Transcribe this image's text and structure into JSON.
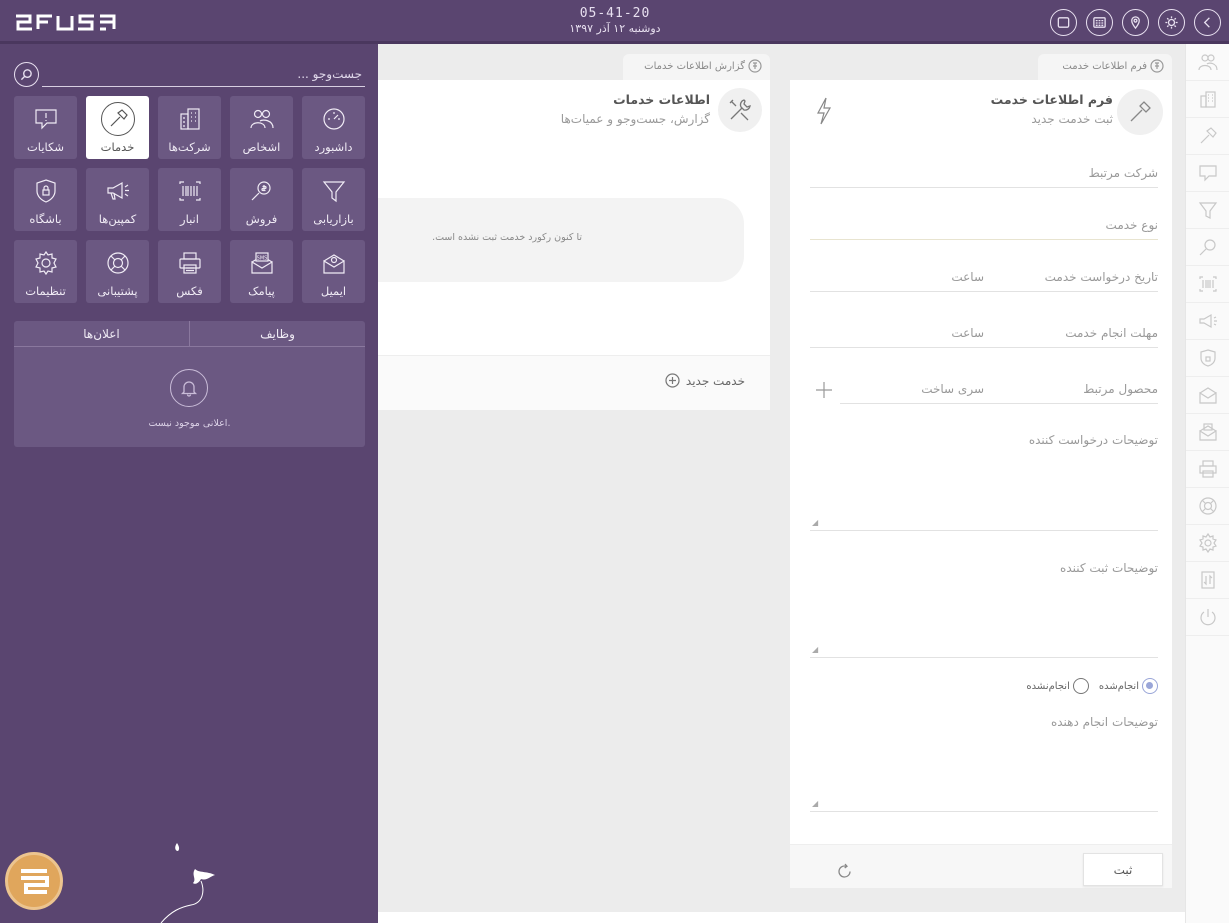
{
  "header": {
    "time": "05-41-20",
    "date": "دوشنبه ۱۲ آذر ۱۳۹۷",
    "icons": [
      "chevron-left-icon",
      "sun-icon",
      "map-pin-icon",
      "calendar-grid-icon",
      "window-icon"
    ]
  },
  "sidebar": {
    "search_placeholder": "جست‌وجو ...",
    "tiles": [
      {
        "label": "داشبورد",
        "icon": "dashboard-icon"
      },
      {
        "label": "اشخاص",
        "icon": "people-icon"
      },
      {
        "label": "شرکت‌ها",
        "icon": "buildings-icon"
      },
      {
        "label": "خدمات",
        "icon": "hammer-icon"
      },
      {
        "label": "شکایات",
        "icon": "complaint-icon"
      },
      {
        "label": "بازاریابی",
        "icon": "funnel-icon"
      },
      {
        "label": "فروش",
        "icon": "sales-icon"
      },
      {
        "label": "انبار",
        "icon": "barcode-icon"
      },
      {
        "label": "کمپین‌ها",
        "icon": "megaphone-icon"
      },
      {
        "label": "باشگاه",
        "icon": "shield-lock-icon"
      },
      {
        "label": "ایمیل",
        "icon": "email-icon"
      },
      {
        "label": "پیامک",
        "icon": "sms-icon"
      },
      {
        "label": "فکس",
        "icon": "printer-icon"
      },
      {
        "label": "پشتیبانی",
        "icon": "lifebuoy-icon"
      },
      {
        "label": "تنظیمات",
        "icon": "gear-icon"
      }
    ],
    "tabs": {
      "tasks": "وظایف",
      "announcements": "اعلان‌ها"
    },
    "announcements_empty": "اعلانی موجود نیست."
  },
  "report": {
    "tab_label": "گزارش اطلاعات خدمات",
    "title": "اطلاعات خدمات",
    "subtitle": "گزارش، جست‌وجو و عمیات‌ها",
    "empty": "تا کنون رکورد خدمت ثبت نشده است.",
    "new_service": "خدمت جدید"
  },
  "form": {
    "tab_label": "فرم اطلاعات خدمت",
    "title": "فرم اطلاعات خدمت",
    "subtitle": "ثبت خدمت جدید",
    "fields": {
      "company": "شرکت مرتبط",
      "service_type": "نوع خدمت",
      "request_date": "تاریخ درخواست خدمت",
      "request_time": "ساعت",
      "deadline": "مهلت انجام خدمت",
      "deadline_time": "ساعت",
      "product": "محصول مرتبط",
      "serial": "سری ساخت",
      "requester_notes": "توضیحات درخواست کننده",
      "registrar_notes": "توضیحات ثبت کننده",
      "performer_notes": "توضیحات انجام دهنده"
    },
    "status": {
      "done": "انجام‌شده",
      "not_done": "انجام‌نشده",
      "selected": "done"
    },
    "submit": "ثبت"
  },
  "colors": {
    "sidebar": "#5a4570",
    "tile": "#6b5882",
    "accent": "#e0a65c"
  }
}
